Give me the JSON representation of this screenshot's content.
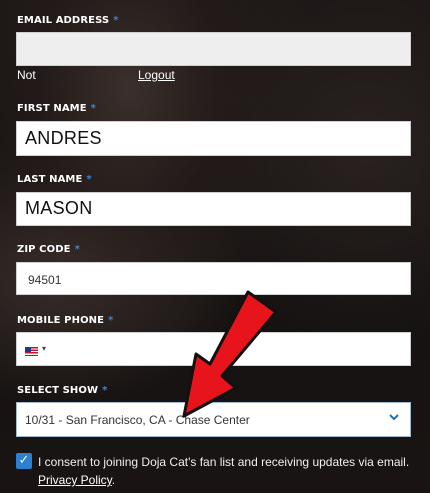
{
  "form": {
    "email": {
      "label": "EMAIL ADDRESS",
      "required": "*",
      "value": ""
    },
    "not_prefix": "Not",
    "logout": "Logout",
    "first_name": {
      "label": "FIRST NAME",
      "required": "*",
      "value": "ANDRES"
    },
    "last_name": {
      "label": "LAST NAME",
      "required": "*",
      "value": "MASON"
    },
    "zip": {
      "label": "ZIP CODE",
      "required": "*",
      "value": "94501"
    },
    "mobile": {
      "label": "MOBILE PHONE",
      "required": "*",
      "country_flag": "us-flag-icon",
      "dropdown_caret": "▾"
    },
    "show": {
      "label": "SELECT SHOW",
      "required": "*",
      "selected": "10/31 - San Francisco, CA - Chase Center"
    },
    "consent": {
      "checked": true,
      "text": "I consent to joining Doja Cat's fan list and receiving updates via email.",
      "privacy_link": "Privacy Policy",
      "trailing": "."
    }
  },
  "annotation": {
    "arrow_color": "#e8141b"
  },
  "colors": {
    "accent": "#3a86d6",
    "checkbox": "#2d7fd1"
  }
}
